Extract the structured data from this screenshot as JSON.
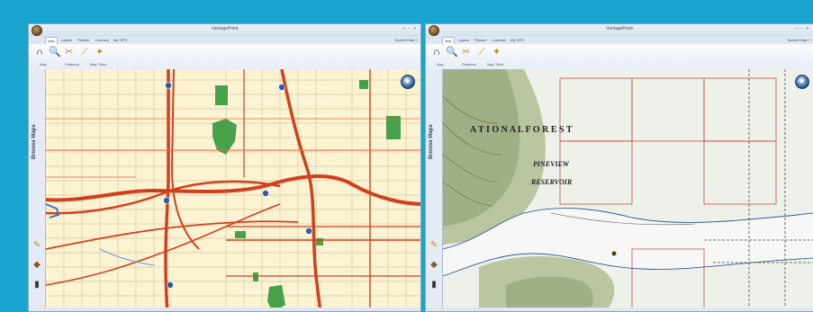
{
  "colors": {
    "background": "#1aa5cf",
    "street_base": "#fbf3d2",
    "major_road": "#d1401e",
    "park": "#46a24a",
    "topo_base": "#eef1ea"
  },
  "windows": [
    {
      "title": "VantagePoint",
      "window_controls": "– ▫ ×",
      "tabs": [
        "Map",
        "Layers",
        "Planner",
        "Connect",
        "My GPS"
      ],
      "right_links": "Search  Help  ?",
      "ribbon_groups": [
        "Map",
        "Features",
        "Map Tools"
      ],
      "sidebar_label": "Browse Maps",
      "map_type": "street"
    },
    {
      "title": "VantagePoint",
      "window_controls": "– ▫ ×",
      "tabs": [
        "Map",
        "Layers",
        "Planner",
        "Connect",
        "My GPS"
      ],
      "right_links": "Search  Help  ?",
      "ribbon_groups": [
        "Map",
        "Features",
        "Map Tools"
      ],
      "sidebar_label": "Browse Maps",
      "map_type": "topo",
      "map_labels": {
        "forest": "A T I O N A L   F O R E S T",
        "reservoir_1": "PINEVIEW",
        "reservoir_2": "RESERVOIR"
      }
    }
  ]
}
